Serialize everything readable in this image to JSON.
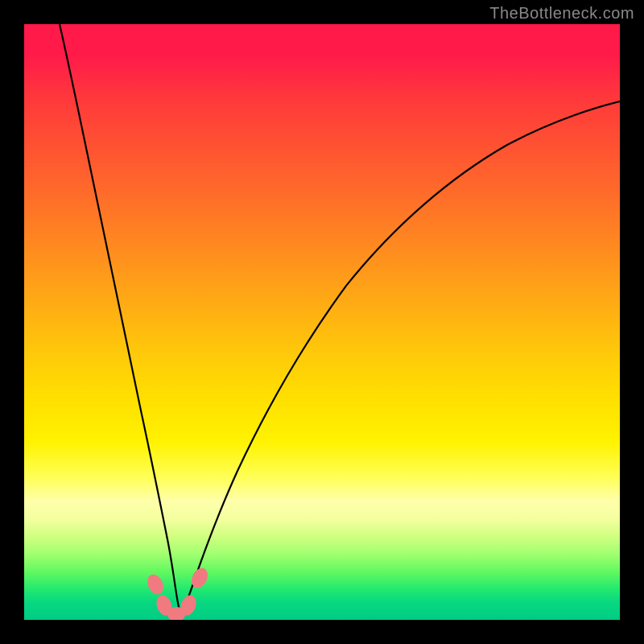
{
  "watermark": "TheBottleneck.com",
  "chart_data": {
    "type": "line",
    "title": "",
    "xlabel": "",
    "ylabel": "",
    "xlim": [
      0,
      100
    ],
    "ylim": [
      0,
      100
    ],
    "grid": false,
    "legend": false,
    "note": "Axes are percent of plot width/height; y is mismatch/bottleneck percentage with 0 at bottom. Colored background is a vertical heat gradient (red=high mismatch at top, green=low at bottom). Curve shows two branches meeting at the minimum; pink blobs mark the optimal region near x≈25.",
    "series": [
      {
        "name": "left-branch",
        "x": [
          6,
          8,
          10,
          12,
          14,
          16,
          18,
          20,
          22,
          23.5,
          24.5,
          25.5
        ],
        "y": [
          100,
          90,
          80,
          69,
          58,
          47,
          36,
          25,
          15,
          8,
          3,
          0
        ]
      },
      {
        "name": "right-branch",
        "x": [
          25.5,
          27,
          29,
          31,
          33,
          36,
          40,
          45,
          50,
          56,
          63,
          72,
          82,
          92,
          100
        ],
        "y": [
          0,
          3,
          8,
          14,
          20,
          28,
          37,
          47,
          55,
          62,
          69,
          75,
          80,
          84,
          86
        ]
      }
    ],
    "markers": [
      {
        "name": "optimal-blob",
        "x": 22.0,
        "y": 6.0
      },
      {
        "name": "optimal-blob",
        "x": 23.5,
        "y": 2.5
      },
      {
        "name": "optimal-blob",
        "x": 25.5,
        "y": 1.0
      },
      {
        "name": "optimal-blob",
        "x": 27.5,
        "y": 2.5
      },
      {
        "name": "optimal-blob",
        "x": 29.5,
        "y": 7.0
      }
    ],
    "gradient_stops": [
      {
        "pos": 0.0,
        "color": "#ff1a4a"
      },
      {
        "pos": 0.05,
        "color": "#ff1a4a"
      },
      {
        "pos": 0.13,
        "color": "#ff3a3a"
      },
      {
        "pos": 0.28,
        "color": "#ff6a2a"
      },
      {
        "pos": 0.42,
        "color": "#ff9a1a"
      },
      {
        "pos": 0.55,
        "color": "#ffc80a"
      },
      {
        "pos": 0.63,
        "color": "#ffe000"
      },
      {
        "pos": 0.7,
        "color": "#fff200"
      },
      {
        "pos": 0.76,
        "color": "#ffff55"
      },
      {
        "pos": 0.8,
        "color": "#ffffaa"
      },
      {
        "pos": 0.83,
        "color": "#f4ffa0"
      },
      {
        "pos": 0.86,
        "color": "#d0ff80"
      },
      {
        "pos": 0.89,
        "color": "#a0ff70"
      },
      {
        "pos": 0.92,
        "color": "#60f860"
      },
      {
        "pos": 0.95,
        "color": "#20e870"
      },
      {
        "pos": 0.97,
        "color": "#08d880"
      },
      {
        "pos": 1.0,
        "color": "#00cc85"
      }
    ]
  }
}
